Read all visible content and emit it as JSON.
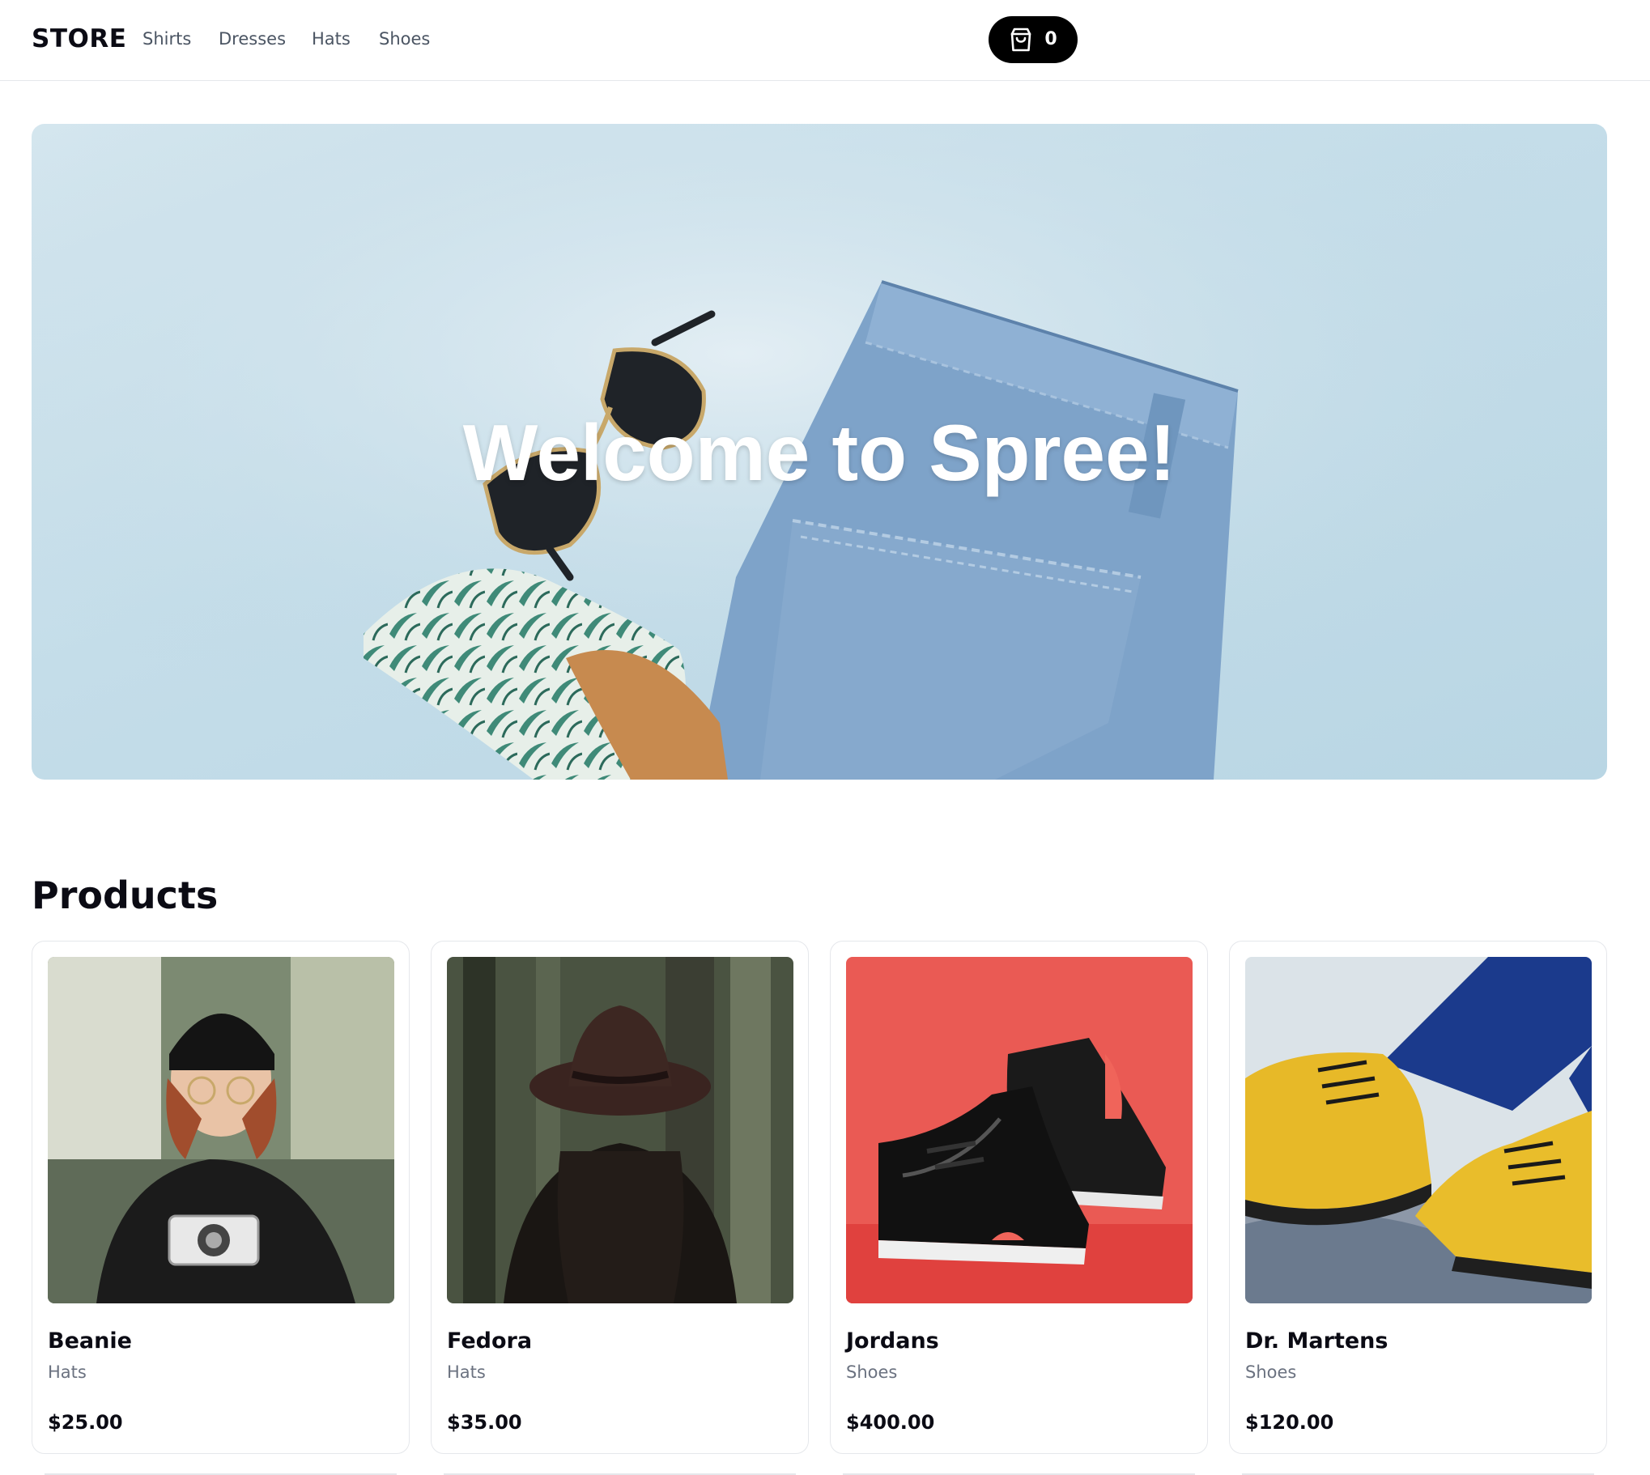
{
  "header": {
    "brand": "STORE",
    "nav": [
      {
        "label": "Shirts"
      },
      {
        "label": "Dresses"
      },
      {
        "label": "Hats"
      },
      {
        "label": "Shoes"
      }
    ],
    "cart": {
      "icon": "shopping-bag-icon",
      "count": "0"
    }
  },
  "hero": {
    "title": "Welcome to Spree!"
  },
  "products": {
    "title": "Products",
    "items": [
      {
        "name": "Beanie",
        "category": "Hats",
        "price": "$25.00"
      },
      {
        "name": "Fedora",
        "category": "Hats",
        "price": "$35.00"
      },
      {
        "name": "Jordans",
        "category": "Shoes",
        "price": "$400.00"
      },
      {
        "name": "Dr. Martens",
        "category": "Shoes",
        "price": "$120.00"
      }
    ]
  },
  "colors": {
    "accent": "#000000",
    "text": "#0b0b14",
    "muted": "#6b7280",
    "border": "#e5e7eb"
  }
}
